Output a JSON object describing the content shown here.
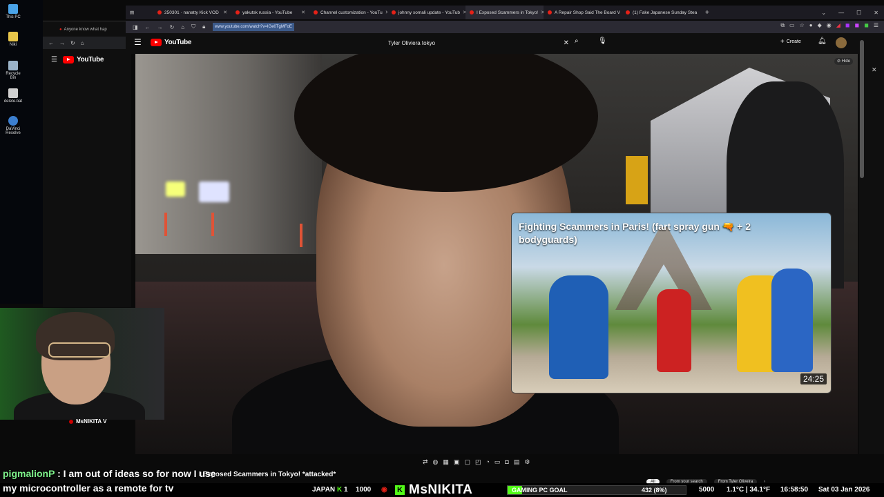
{
  "desktop": {
    "icons": [
      {
        "label": "This PC"
      },
      {
        "label": "Niki"
      },
      {
        "label": "Recycle Bin"
      },
      {
        "label": "delete.bat"
      },
      {
        "label": "DaVinci Resolve"
      }
    ]
  },
  "back_window": {
    "tab_title": "Anyone know what hap",
    "logo": "YouTube"
  },
  "tabs": [
    {
      "label": "250301 · nanatty Kick VOD"
    },
    {
      "label": "yakutsk russia - YouTube"
    },
    {
      "label": "Channel customization - YouTu"
    },
    {
      "label": "johnny somali update - YouTub"
    },
    {
      "label": "I Exposed Scammers in Tokyo!"
    },
    {
      "label": "A Repair Shop Said The Board V"
    },
    {
      "label": "(1) Fake Japanese Sunday Stea"
    }
  ],
  "address_bar": {
    "url": "www.youtube.com/watch?v=IGe0TgMFoE"
  },
  "youtube": {
    "logo": "YouTube",
    "search_value": "Tyler Oliviera tokyo",
    "create_label": "Create"
  },
  "end_card": {
    "title": "Fighting Scammers in Paris! (fart spray gun 🔫 + 2 bodyguards)",
    "duration": "24:25",
    "hide_label": "Hide"
  },
  "video_title": "I Exposed Scammers in Tokyo! *attacked*",
  "filter_chips": [
    "All",
    "From your search",
    "From Tyler Oliveira"
  ],
  "webcam": {
    "name": "MsNIKITA V"
  },
  "chat": {
    "username": "pigmalionP",
    "line1": " : I am out of ideas so for now I use",
    "line2": "my microcontroller as a remote for tv"
  },
  "ticker": {
    "location": "JAPAN",
    "count1": "1",
    "count2": "1000",
    "brand": "MsNIKITA",
    "goal_label": "GAMING PC GOAL",
    "goal_value": "432 (8%)",
    "goal_fraction": 0.08,
    "goal_target": "5000",
    "temp": "1.1°C | 34.1°F",
    "time": "16:58:50",
    "date": "Sat 03 Jan 2026"
  }
}
